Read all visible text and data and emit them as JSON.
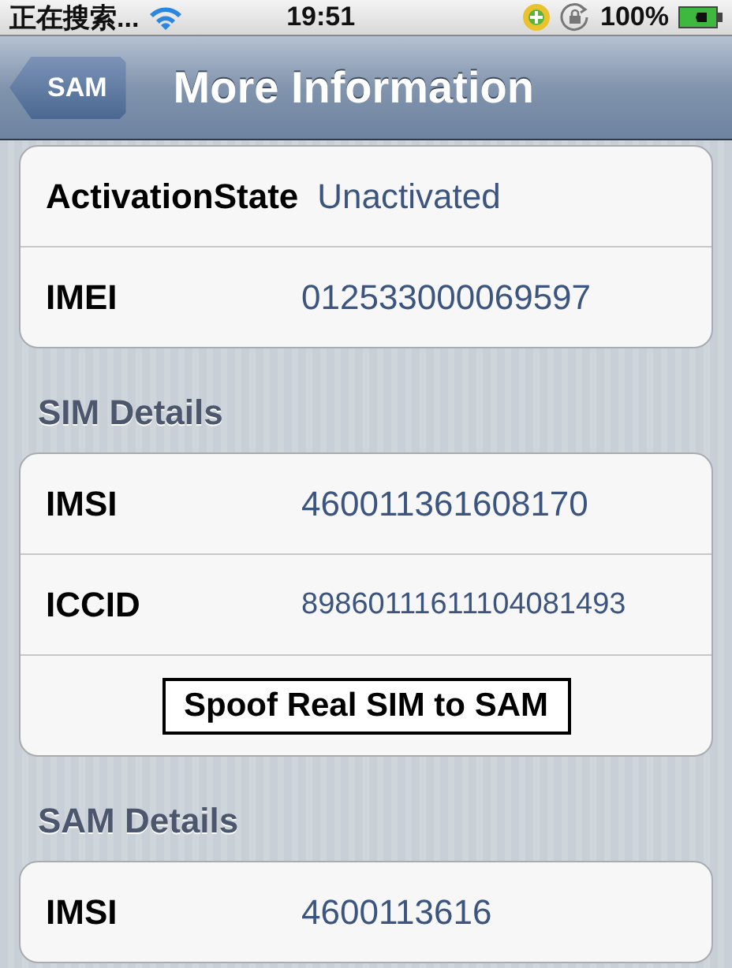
{
  "status_bar": {
    "carrier": "正在搜索...",
    "time": "19:51",
    "battery": "100%"
  },
  "nav_bar": {
    "back": "SAM",
    "title": "More Information"
  },
  "sections": [
    {
      "rows": [
        {
          "kind": "field",
          "label": "ActivationState",
          "value": "Unactivated"
        },
        {
          "kind": "field",
          "label": "IMEI",
          "value": "012533000069597"
        }
      ]
    },
    {
      "header": "SIM Details",
      "rows": [
        {
          "kind": "field",
          "label": "IMSI",
          "value": "460011361608170"
        },
        {
          "kind": "field",
          "label": "ICCID",
          "value": "89860111611104081493",
          "small": true
        },
        {
          "kind": "button",
          "label": "Spoof Real SIM to SAM"
        }
      ]
    },
    {
      "header": "SAM Details",
      "rows": [
        {
          "kind": "field",
          "label": "IMSI",
          "value": "4600113616"
        }
      ]
    }
  ]
}
